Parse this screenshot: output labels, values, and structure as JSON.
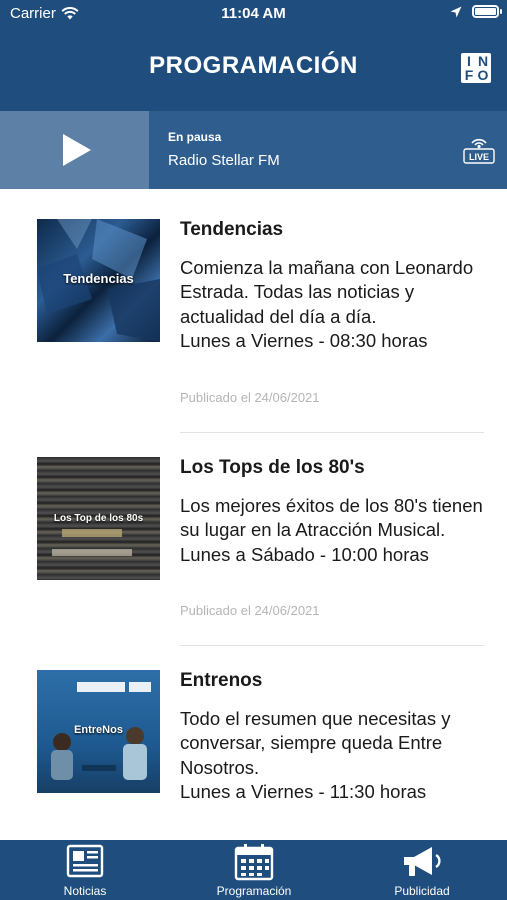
{
  "status_bar": {
    "carrier": "Carrier",
    "time": "11:04 AM"
  },
  "header": {
    "title": "PROGRAMACIÓN",
    "info_letters": [
      "I",
      "N",
      "F",
      "O"
    ]
  },
  "player": {
    "state": "En pausa",
    "station": "Radio Stellar FM",
    "live_label": "LIVE"
  },
  "programs": [
    {
      "thumb_label": "Tendencias",
      "title": "Tendencias",
      "description": "Comienza la mañana con Leonardo Estrada. Todas las noticias y actualidad del día a día.",
      "schedule": "Lunes a Viernes - 08:30 horas",
      "published": "Publicado el 24/06/2021"
    },
    {
      "thumb_label": "Los Top de los 80s",
      "title": "Los Tops de los 80's",
      "description": "Los mejores éxitos de los 80's tienen su lugar en la Atracción Musical.",
      "schedule": "Lunes a Sábado - 10:00 horas",
      "published": "Publicado el 24/06/2021"
    },
    {
      "thumb_label": "EntreNos",
      "title": "Entrenos",
      "description": "Todo el resumen que necesitas y conversar, siempre queda Entre Nosotros.",
      "schedule": "Lunes a Viernes - 11:30 horas",
      "published": ""
    }
  ],
  "tabs": [
    {
      "label": "Noticias",
      "icon": "newspaper-icon"
    },
    {
      "label": "Programación",
      "icon": "calendar-icon"
    },
    {
      "label": "Publicidad",
      "icon": "megaphone-icon"
    }
  ]
}
